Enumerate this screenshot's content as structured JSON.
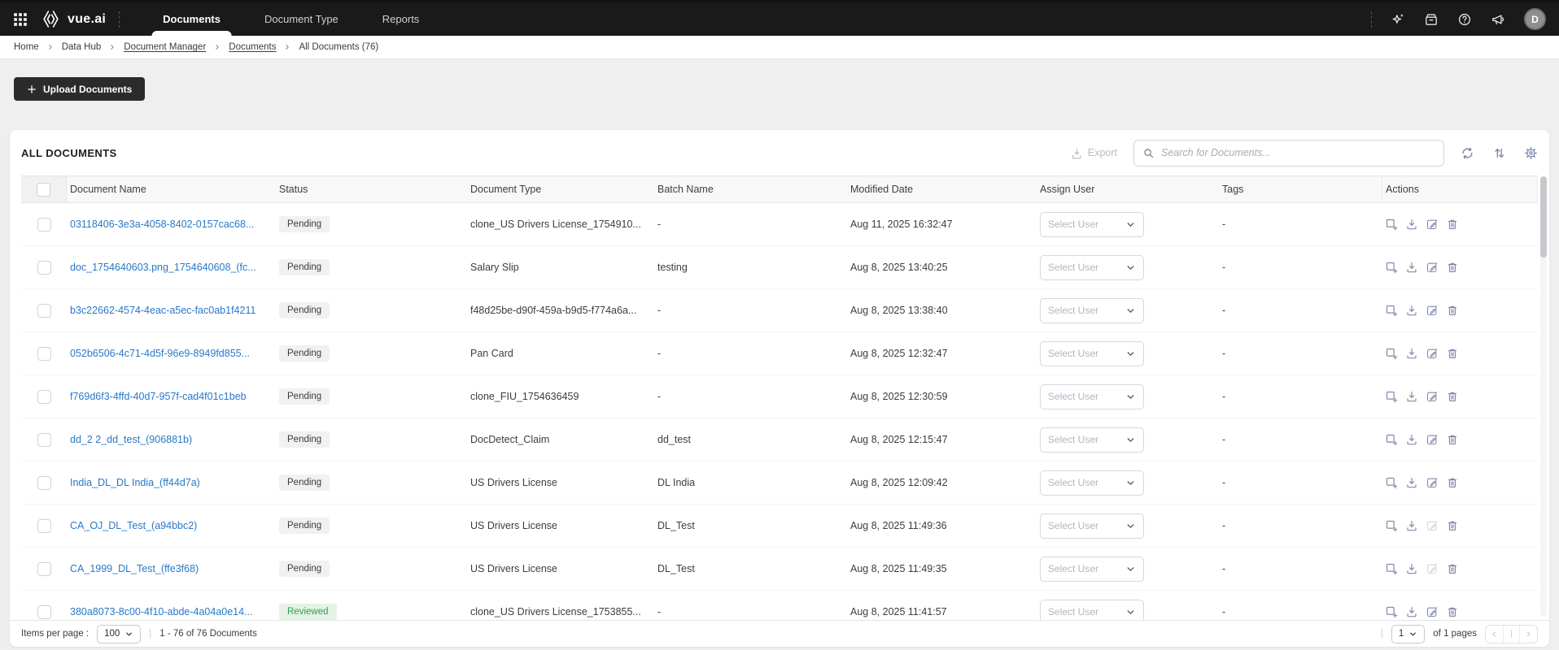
{
  "topbar": {
    "logo_text": "vue.ai",
    "nav": [
      {
        "label": "Documents"
      },
      {
        "label": "Document Type"
      },
      {
        "label": "Reports"
      }
    ],
    "avatar_initial": "D"
  },
  "breadcrumb": {
    "items": [
      {
        "label": "Home"
      },
      {
        "label": "Data Hub"
      },
      {
        "label": "Document Manager"
      },
      {
        "label": "Documents"
      },
      {
        "label": "All Documents (76)"
      }
    ]
  },
  "actions_bar": {
    "upload_label": "Upload Documents"
  },
  "panel": {
    "title": "ALL DOCUMENTS",
    "export_label": "Export",
    "search_placeholder": "Search for Documents..."
  },
  "table": {
    "columns": [
      "Document Name",
      "Status",
      "Document Type",
      "Batch Name",
      "Modified Date",
      "Assign User",
      "Tags",
      "Actions"
    ],
    "assign_placeholder": "Select User",
    "rows": [
      {
        "name": "03118406-3e3a-4058-8402-0157cac68...",
        "status": "Pending",
        "type": "clone_US Drivers License_1754910...",
        "batch": "-",
        "modified": "Aug 11, 2025 16:32:47",
        "tags": "-",
        "edit_disabled": false
      },
      {
        "name": "doc_1754640603.png_1754640608_(fc...",
        "status": "Pending",
        "type": "Salary Slip",
        "batch": "testing",
        "modified": "Aug 8, 2025 13:40:25",
        "tags": "-",
        "edit_disabled": false
      },
      {
        "name": "b3c22662-4574-4eac-a5ec-fac0ab1f4211",
        "status": "Pending",
        "type": "f48d25be-d90f-459a-b9d5-f774a6a...",
        "batch": "-",
        "modified": "Aug 8, 2025 13:38:40",
        "tags": "-",
        "edit_disabled": false
      },
      {
        "name": "052b6506-4c71-4d5f-96e9-8949fd855...",
        "status": "Pending",
        "type": "Pan Card",
        "batch": "-",
        "modified": "Aug 8, 2025 12:32:47",
        "tags": "-",
        "edit_disabled": false
      },
      {
        "name": "f769d6f3-4ffd-40d7-957f-cad4f01c1beb",
        "status": "Pending",
        "type": "clone_FIU_1754636459",
        "batch": "-",
        "modified": "Aug 8, 2025 12:30:59",
        "tags": "-",
        "edit_disabled": false
      },
      {
        "name": "dd_2 2_dd_test_(906881b)",
        "status": "Pending",
        "type": "DocDetect_Claim",
        "batch": "dd_test",
        "modified": "Aug 8, 2025 12:15:47",
        "tags": "-",
        "edit_disabled": false
      },
      {
        "name": "India_DL_DL India_(ff44d7a)",
        "status": "Pending",
        "type": "US Drivers License",
        "batch": "DL India",
        "modified": "Aug 8, 2025 12:09:42",
        "tags": "-",
        "edit_disabled": false
      },
      {
        "name": "CA_OJ_DL_Test_(a94bbc2)",
        "status": "Pending",
        "type": "US Drivers License",
        "batch": "DL_Test",
        "modified": "Aug 8, 2025 11:49:36",
        "tags": "-",
        "edit_disabled": true
      },
      {
        "name": "CA_1999_DL_Test_(ffe3f68)",
        "status": "Pending",
        "type": "US Drivers License",
        "batch": "DL_Test",
        "modified": "Aug 8, 2025 11:49:35",
        "tags": "-",
        "edit_disabled": true
      },
      {
        "name": "380a8073-8c00-4f10-abde-4a04a0e14...",
        "status": "Reviewed",
        "type": "clone_US Drivers License_1753855...",
        "batch": "-",
        "modified": "Aug 8, 2025 11:41:57",
        "tags": "-",
        "edit_disabled": false
      }
    ]
  },
  "footer": {
    "items_per_page_label": "Items per page :",
    "items_per_page_value": "100",
    "range_text": "1 - 76 of 76 Documents",
    "page_value": "1",
    "pages_text": "of 1 pages"
  },
  "colors": {
    "topbar_bg": "#1a1a1a",
    "page_bg": "#efefef",
    "btn_dark": "#2b2b2b",
    "accent_link": "#2878c8",
    "pending_bg": "#f1f1f2",
    "pending_text": "#3b3b3b",
    "reviewed_bg": "#e4f3e6",
    "reviewed_text": "#2f9e4f",
    "icon_muted": "#8289ad"
  }
}
